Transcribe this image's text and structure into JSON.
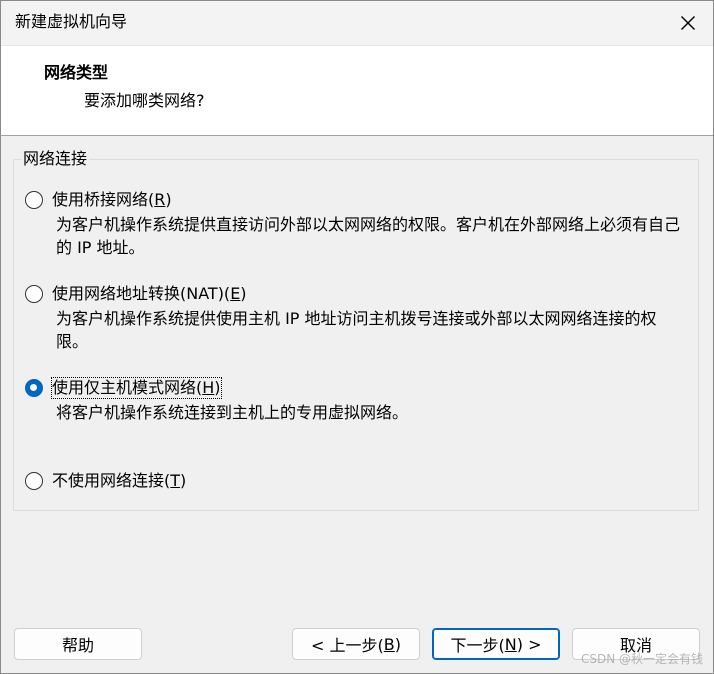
{
  "window": {
    "title": "新建虚拟机向导"
  },
  "header": {
    "title": "网络类型",
    "subtitle": "要添加哪类网络?"
  },
  "group": {
    "title": "网络连接",
    "options": [
      {
        "label_prefix": "使用桥接网络(",
        "mnemonic": "R",
        "label_suffix": ")",
        "description": "为客户机操作系统提供直接访问外部以太网网络的权限。客户机在外部网络上必须有自己的 IP 地址。",
        "selected": false
      },
      {
        "label_prefix": "使用网络地址转换(NAT)(",
        "mnemonic": "E",
        "label_suffix": ")",
        "description": "为客户机操作系统提供使用主机 IP 地址访问主机拨号连接或外部以太网网络连接的权限。",
        "selected": false
      },
      {
        "label_prefix": "使用仅主机模式网络(",
        "mnemonic": "H",
        "label_suffix": ")",
        "description": "将客户机操作系统连接到主机上的专用虚拟网络。",
        "selected": true
      },
      {
        "label_prefix": "不使用网络连接(",
        "mnemonic": "T",
        "label_suffix": ")",
        "description": "",
        "selected": false
      }
    ]
  },
  "buttons": {
    "help": "帮助",
    "back_prefix": "< 上一步(",
    "back_mnemonic": "B",
    "back_suffix": ")",
    "next_prefix": "下一步(",
    "next_mnemonic": "N",
    "next_suffix": ") >",
    "cancel": "取消"
  },
  "watermark": "CSDN @秋一定会有钱",
  "colors": {
    "accent": "#0067c0",
    "background": "#f0f0f0",
    "header_background": "#ffffff"
  },
  "icons": {
    "close": "close-icon"
  }
}
